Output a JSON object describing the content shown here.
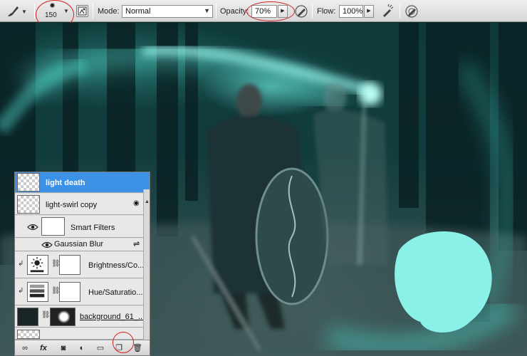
{
  "options_bar": {
    "brush_size": "150",
    "mode_label": "Mode:",
    "mode_value": "Normal",
    "opacity_label": "Opacity:",
    "opacity_value": "70%",
    "flow_label": "Flow:",
    "flow_value": "100%",
    "icons": [
      "brush-tool-icon",
      "brush-panel-toggle-icon",
      "pressure-opacity-icon",
      "airbrush-icon",
      "pressure-size-icon"
    ]
  },
  "layers": [
    {
      "name": "light death",
      "selected": true,
      "type": "pixel"
    },
    {
      "name": "light-swirl copy",
      "selected": false,
      "type": "smart-object"
    },
    {
      "name": "Smart Filters",
      "selected": false,
      "type": "smart-filters"
    },
    {
      "name": "Gaussian Blur",
      "selected": false,
      "type": "filter"
    },
    {
      "name": "Brightness/Co...",
      "selected": false,
      "type": "adjustment"
    },
    {
      "name": "Hue/Saturatio...",
      "selected": false,
      "type": "adjustment"
    },
    {
      "name": "background_61_...",
      "selected": false,
      "type": "smart-object-masked"
    }
  ],
  "panel_buttons": [
    "link-layers-icon",
    "fx-icon",
    "layer-mask-icon",
    "adjustment-layer-icon",
    "new-group-icon",
    "new-layer-icon",
    "trash-icon"
  ],
  "colors": {
    "selection": "#3d92e8",
    "annotation": "#d42020",
    "brush_preview": "#8af0e8",
    "glow": "#7ffcef"
  }
}
